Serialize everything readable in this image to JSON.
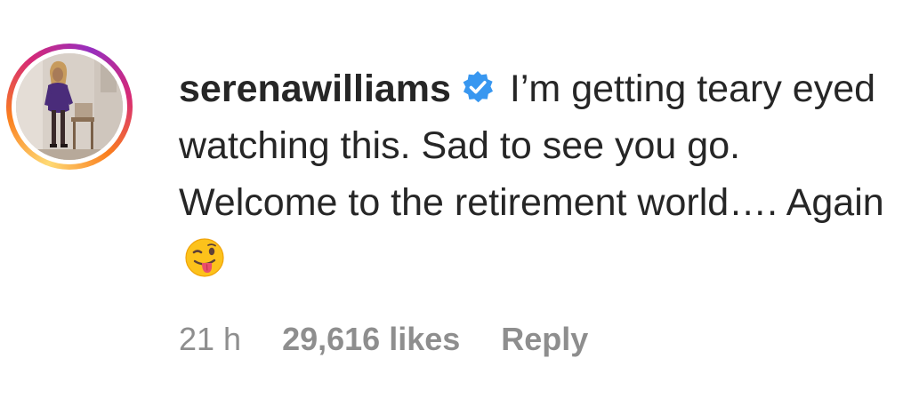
{
  "comment": {
    "avatar_icon": "profile-photo-woman-purple-dress",
    "username": "serenawilliams",
    "verified_icon": "verified-badge-icon",
    "text": "I’m getting teary eyed watching this. Sad to see you go. Welcome to the retirement world…. Again",
    "emoji_icon": "winking-face-with-tongue-icon",
    "time": "21 h",
    "likes": "29,616 likes",
    "reply_label": "Reply"
  },
  "colors": {
    "text": "#262626",
    "meta": "#8e8e8e",
    "verified": "#3897f0",
    "story_ring": [
      "#feda75",
      "#fa7e1e",
      "#d62976",
      "#962fbf"
    ]
  }
}
